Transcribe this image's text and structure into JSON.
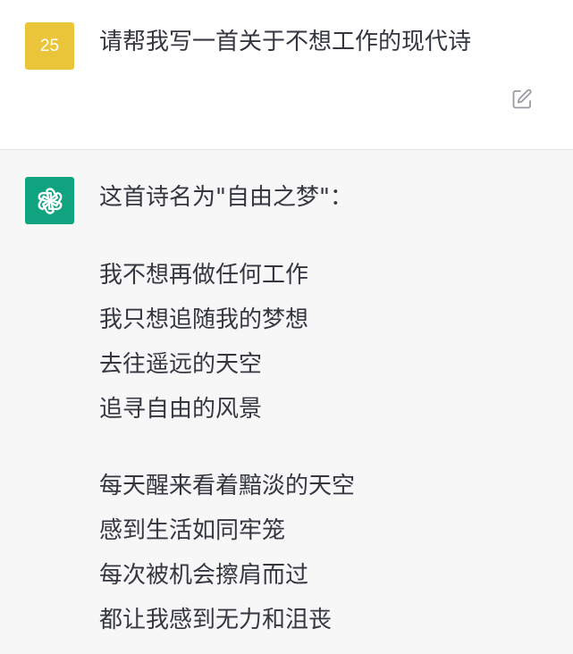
{
  "user_message": {
    "avatar_label": "25",
    "text": "请帮我写一首关于不想工作的现代诗",
    "avatar_color": "#eac53a"
  },
  "assistant_message": {
    "intro": "这首诗名为\"自由之梦\"：",
    "avatar_color": "#10a37f",
    "avatar_icon": "openai-logo-icon",
    "stanzas": [
      {
        "lines": [
          "我不想再做任何工作",
          "我只想追随我的梦想",
          "去往遥远的天空",
          "追寻自由的风景"
        ]
      },
      {
        "lines": [
          "每天醒来看着黯淡的天空",
          "感到生活如同牢笼",
          "每次被机会擦肩而过",
          "都让我感到无力和沮丧"
        ]
      }
    ]
  },
  "icons": {
    "edit": "edit-icon"
  }
}
